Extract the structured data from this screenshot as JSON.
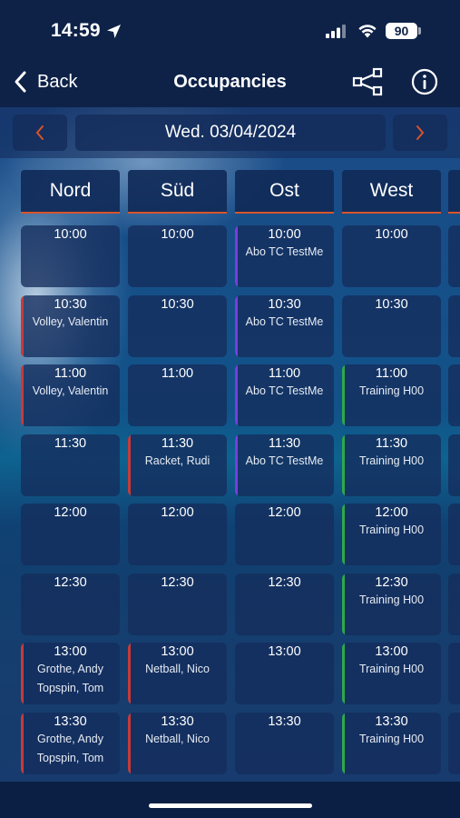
{
  "status_bar": {
    "time": "14:59",
    "battery": "90",
    "icons": [
      "location-arrow-icon",
      "signal-icon",
      "wifi-icon",
      "battery-icon"
    ]
  },
  "nav": {
    "back_label": "Back",
    "title": "Occupancies",
    "icons": [
      "chevron-left-icon",
      "share-icon",
      "info-icon"
    ]
  },
  "date_bar": {
    "date": "Wed. 03/04/2024",
    "prev_icon": "chevron-left-icon",
    "next_icon": "chevron-right-icon"
  },
  "colors": {
    "accent": "#d8542c",
    "red": "#c73a3a",
    "purple": "#7c3ce0",
    "green": "#2fa84a",
    "background": "#0f2a55",
    "slot": "#142d5c"
  },
  "columns": [
    {
      "name": "Nord"
    },
    {
      "name": "Süd"
    },
    {
      "name": "Ost"
    },
    {
      "name": "West"
    }
  ],
  "rows": [
    {
      "time": "10:00",
      "slots": [
        {
          "lines": [],
          "color": ""
        },
        {
          "lines": [],
          "color": ""
        },
        {
          "lines": [
            "Abo TC TestMe"
          ],
          "color": "purple"
        },
        {
          "lines": [],
          "color": ""
        }
      ]
    },
    {
      "time": "10:30",
      "slots": [
        {
          "lines": [
            "Volley, Valentin"
          ],
          "color": "red"
        },
        {
          "lines": [],
          "color": ""
        },
        {
          "lines": [
            "Abo TC TestMe"
          ],
          "color": "purple"
        },
        {
          "lines": [],
          "color": ""
        }
      ]
    },
    {
      "time": "11:00",
      "slots": [
        {
          "lines": [
            "Volley, Valentin"
          ],
          "color": "red"
        },
        {
          "lines": [],
          "color": ""
        },
        {
          "lines": [
            "Abo TC TestMe"
          ],
          "color": "purple"
        },
        {
          "lines": [
            "Training H00"
          ],
          "color": "green"
        }
      ]
    },
    {
      "time": "11:30",
      "slots": [
        {
          "lines": [],
          "color": ""
        },
        {
          "lines": [
            "Racket, Rudi"
          ],
          "color": "red"
        },
        {
          "lines": [
            "Abo TC TestMe"
          ],
          "color": "purple"
        },
        {
          "lines": [
            "Training H00"
          ],
          "color": "green"
        }
      ]
    },
    {
      "time": "12:00",
      "slots": [
        {
          "lines": [],
          "color": ""
        },
        {
          "lines": [],
          "color": ""
        },
        {
          "lines": [],
          "color": ""
        },
        {
          "lines": [
            "Training H00"
          ],
          "color": "green"
        }
      ]
    },
    {
      "time": "12:30",
      "slots": [
        {
          "lines": [],
          "color": ""
        },
        {
          "lines": [],
          "color": ""
        },
        {
          "lines": [],
          "color": ""
        },
        {
          "lines": [
            "Training H00"
          ],
          "color": "green"
        }
      ]
    },
    {
      "time": "13:00",
      "slots": [
        {
          "lines": [
            "Grothe, Andy",
            "Topspin, Tom"
          ],
          "color": "red"
        },
        {
          "lines": [
            "Netball, Nico"
          ],
          "color": "red"
        },
        {
          "lines": [],
          "color": ""
        },
        {
          "lines": [
            "Training H00"
          ],
          "color": "green"
        }
      ]
    },
    {
      "time": "13:30",
      "slots": [
        {
          "lines": [
            "Grothe, Andy",
            "Topspin, Tom"
          ],
          "color": "red"
        },
        {
          "lines": [
            "Netball, Nico"
          ],
          "color": "red"
        },
        {
          "lines": [],
          "color": ""
        },
        {
          "lines": [
            "Training H00"
          ],
          "color": "green"
        }
      ]
    }
  ]
}
